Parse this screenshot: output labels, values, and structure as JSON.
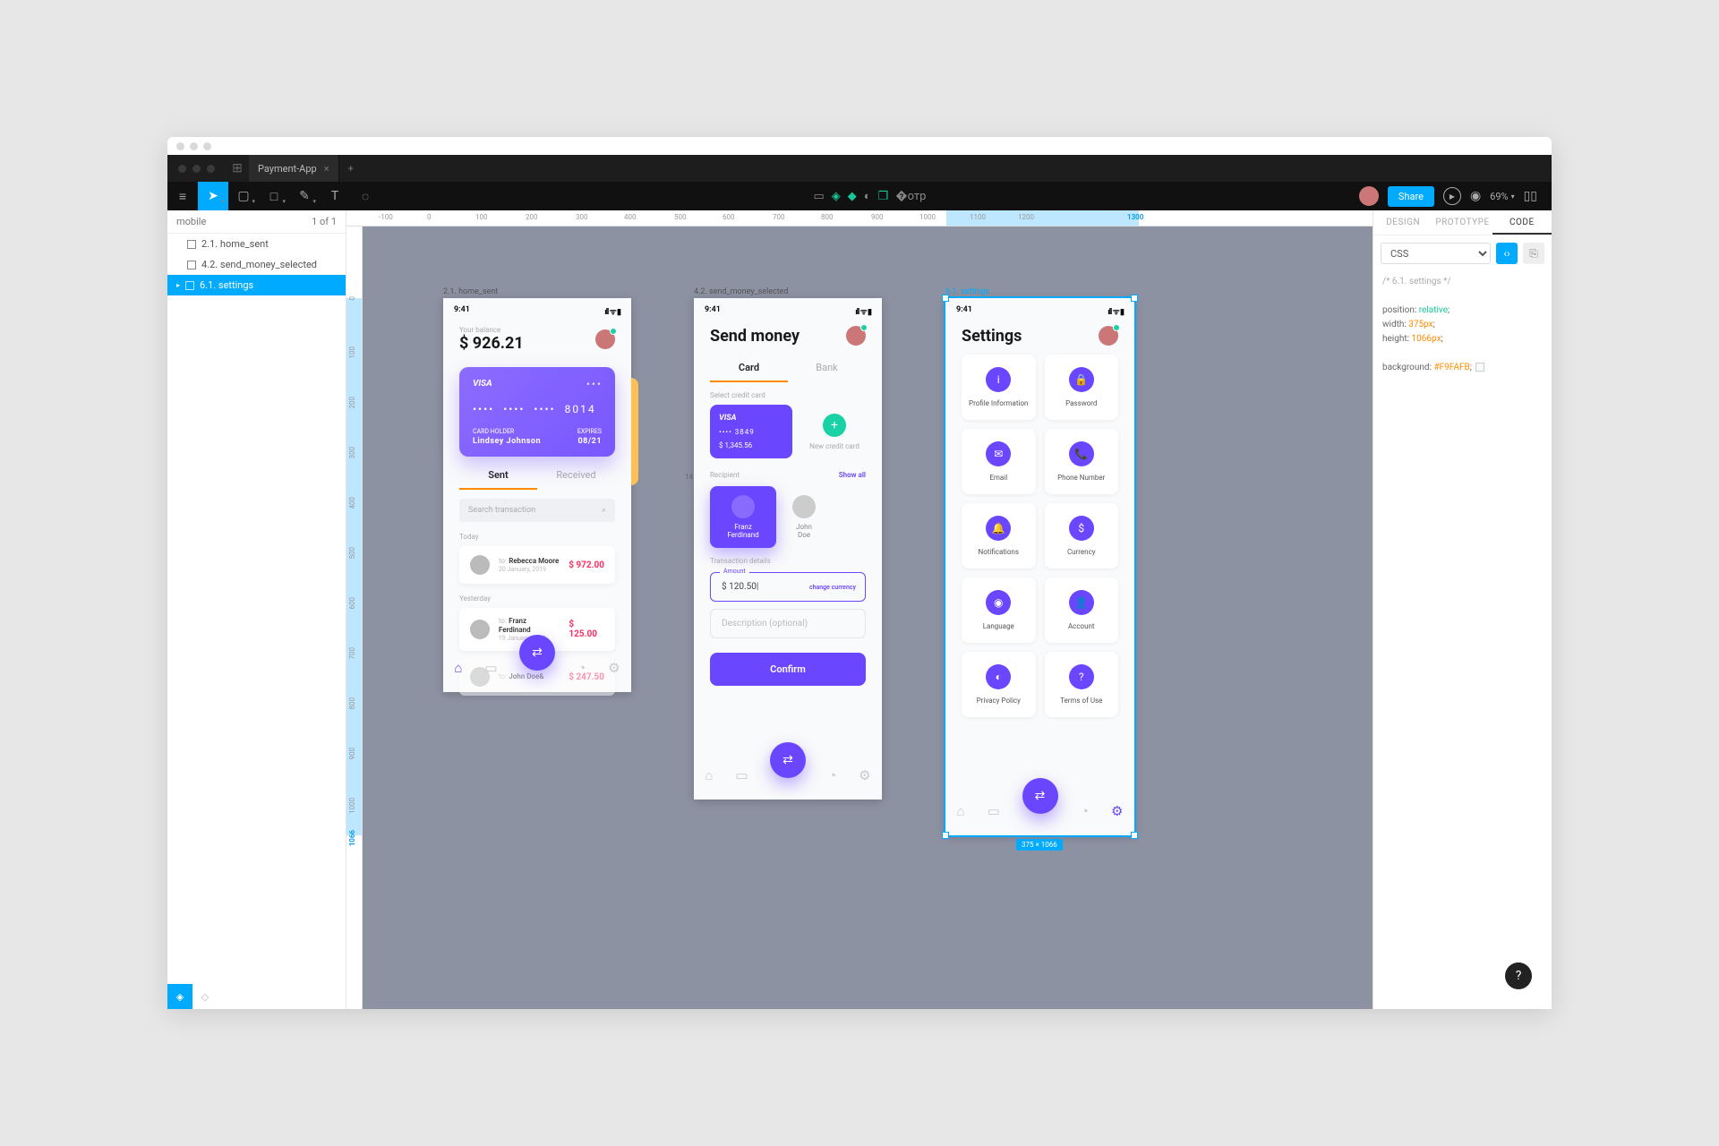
{
  "tab_title": "Payment-App",
  "share_label": "Share",
  "zoom": "69%",
  "left": {
    "title": "mobile",
    "count": "1 of 1",
    "items": [
      {
        "label": "2.1. home_sent"
      },
      {
        "label": "4.2. send_money_selected"
      },
      {
        "label": "6.1. settings"
      }
    ]
  },
  "right_tabs": [
    "DESIGN",
    "PROTOTYPE",
    "CODE"
  ],
  "code_lang": "CSS",
  "code": {
    "comment": "/* 6.1. settings */",
    "l1a": "position:",
    "l1b": "relative",
    "l1c": ";",
    "l2a": "width:",
    "l2b": "375px",
    "l2c": ";",
    "l3a": "height:",
    "l3b": "1066px",
    "l3c": ";",
    "l4a": "background:",
    "l4b": "#F9FAFB",
    "l4c": ";"
  },
  "ruler_h": [
    "-100",
    "0",
    "100",
    "200",
    "300",
    "400",
    "500",
    "600",
    "700",
    "800",
    "900",
    "1000",
    "1100",
    "1200",
    "1300"
  ],
  "ruler_v": [
    "0",
    "100",
    "200",
    "300",
    "400",
    "500",
    "600",
    "700",
    "800",
    "900",
    "1000",
    "1066"
  ],
  "art1": {
    "label": "2.1. home_sent",
    "time": "9:41",
    "sub": "Your balance",
    "balance": "$ 926.21",
    "card": {
      "brand": "VISA",
      "num": [
        "••••",
        "••••",
        "••••",
        "8014"
      ],
      "holder_l": "CARD HOLDER",
      "holder": "Lindsey Johnson",
      "exp_l": "EXPIRES",
      "exp": "08/21"
    },
    "tabs": [
      "Sent",
      "Received"
    ],
    "search_ph": "Search transaction",
    "g1": "Today",
    "tx1": {
      "pre": "to:",
      "name": "Rebecca Moore",
      "date": "20 January, 2019",
      "amt": "$ 972.00"
    },
    "g2": "Yesterday",
    "tx2": {
      "pre": "to:",
      "name": "Franz Ferdinand",
      "date": "19 January, 2019",
      "amt": "$ 125.00"
    },
    "tx3": {
      "pre": "to:",
      "name": "John Doe&",
      "amt": "$ 247.50"
    }
  },
  "art2": {
    "label": "4.2. send_money_selected",
    "time": "9:41",
    "title": "Send money",
    "tabs": [
      "Card",
      "Bank"
    ],
    "sel_l": "Select credit card",
    "card": {
      "brand": "VISA",
      "num": "•••• 3849",
      "bal": "$ 1,345.56"
    },
    "new_l": "New credit card",
    "rec_l": "Recipient",
    "show": "Show all",
    "r1": "Franz Ferdinand",
    "r2": "John Doe",
    "td_l": "Transaction details",
    "amt_l": "Amount",
    "amt_cur": "$",
    "amt_val": "120.50",
    "amt_hint": "change currency",
    "desc_ph": "Description",
    "desc_opt": "(optional)",
    "confirm": "Confirm",
    "peek": "14"
  },
  "art3": {
    "label": "6.1. settings",
    "time": "9:41",
    "title": "Settings",
    "items": [
      {
        "ic": "i",
        "l": "Profile Information"
      },
      {
        "ic": "🔒",
        "l": "Password"
      },
      {
        "ic": "✉",
        "l": "Email"
      },
      {
        "ic": "📞",
        "l": "Phone Number"
      },
      {
        "ic": "🔔",
        "l": "Notifications"
      },
      {
        "ic": "$",
        "l": "Currency"
      },
      {
        "ic": "◉",
        "l": "Language"
      },
      {
        "ic": "👤",
        "l": "Account"
      },
      {
        "ic": "◐",
        "l": "Privacy Policy"
      },
      {
        "ic": "?",
        "l": "Terms of Use"
      }
    ],
    "dim": "375 × 1066"
  }
}
